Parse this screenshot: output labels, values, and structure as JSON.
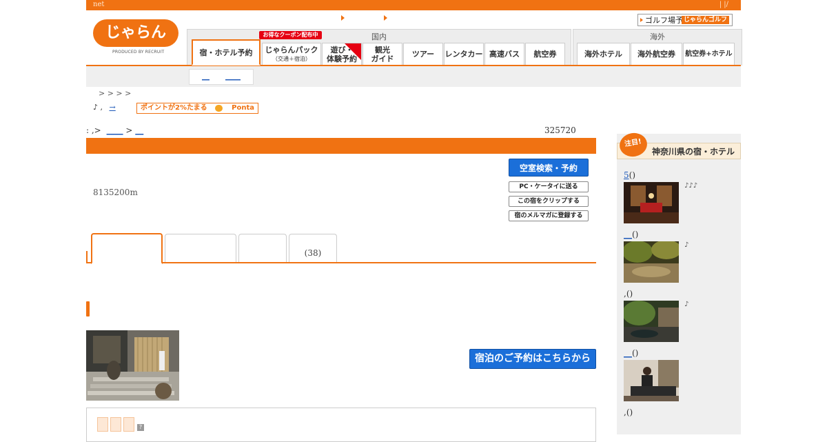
{
  "topbar": {
    "net_label": "net",
    "slashes": "| |/"
  },
  "logo": {
    "wordmark": "じゃらん",
    "tagline": "PRODUCED BY RECRUIT"
  },
  "golf": {
    "label": "ゴルフ場予約",
    "badge": "じゃらんゴルフ"
  },
  "nav": {
    "domestic_label": "国内",
    "overseas_label": "海外",
    "coupon_badge": "お得なクーポン配布中",
    "tabs": [
      {
        "label": "宿・ホテル予約",
        "sub": ""
      },
      {
        "label": "じゃらんパック",
        "sub": "（交通＋宿泊）"
      },
      {
        "label": "遊び・",
        "sub": "体験予約"
      },
      {
        "label": "観光",
        "sub": "ガイド"
      },
      {
        "label": "ツアー",
        "sub": ""
      },
      {
        "label": "レンタカー",
        "sub": ""
      },
      {
        "label": "高速バス",
        "sub": ""
      },
      {
        "label": "航空券",
        "sub": ""
      }
    ],
    "overseas_tabs": [
      {
        "label": "海外ホテル"
      },
      {
        "label": "海外航空券"
      },
      {
        "label": "航空券+ホテル"
      }
    ]
  },
  "subnav": {
    "link1": "__",
    "link2": "____"
  },
  "breadcrumb": {
    "text": "> >       >     >"
  },
  "info": {
    "note": "♪    ,     ",
    "link": "→",
    "ponta_text": "ポイントが2%たまる",
    "ponta_name": "Ponta"
  },
  "breadcrumb2": {
    "prefix": ":        ,>",
    "link1": "____",
    "sep": " > ",
    "link2": "__"
  },
  "result_count": "325720",
  "actions": {
    "search_button": "空室検索・予約",
    "send_button": "PC・ケータイに送る",
    "clip_button": "この宿をクリップする",
    "mail_button": "宿のメルマガに登録する"
  },
  "access_text": "8135200m",
  "tabs": [
    {
      "label": ""
    },
    {
      "label": ""
    },
    {
      "label": ""
    },
    {
      "label": "(38)"
    }
  ],
  "book_button": "宿泊のご予約はこちらから",
  "rating": {
    "help": "?"
  },
  "sidebar": {
    "chumoku": "注目!",
    "title": "神奈川県の宿・ホテル",
    "items": [
      {
        "prefix": "",
        "link": "5",
        "suffix": "()",
        "notes": "♪♪♪"
      },
      {
        "prefix": "",
        "link": "__",
        "suffix": "()",
        "notes": "♪"
      },
      {
        "prefix": "",
        "link": "",
        "suffix": ",()",
        "notes": "♪"
      },
      {
        "prefix": "",
        "link": "__",
        "suffix": "()",
        "notes": ""
      },
      {
        "prefix": "",
        "link": "",
        "suffix": ",()",
        "notes": ""
      }
    ]
  },
  "colors": {
    "accent": "#f07212",
    "button_blue": "#1b6fd9",
    "link": "#1a56b8",
    "coupon_red": "#e60012"
  }
}
